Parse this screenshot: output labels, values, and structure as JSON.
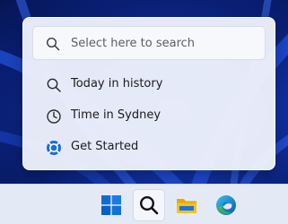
{
  "search": {
    "placeholder": "Select here to search"
  },
  "suggestions": [
    {
      "label": "Today in history",
      "icon": "search-icon"
    },
    {
      "label": "Time in Sydney",
      "icon": "clock-icon"
    },
    {
      "label": "Get Started",
      "icon": "get-started-icon"
    }
  ],
  "taskbar": {
    "items": [
      {
        "name": "start",
        "icon": "windows-logo-icon"
      },
      {
        "name": "search",
        "icon": "search-icon",
        "active": true
      },
      {
        "name": "file-explorer",
        "icon": "folder-icon"
      },
      {
        "name": "edge",
        "icon": "edge-browser-icon"
      }
    ]
  },
  "colors": {
    "wallpaper": "#1236b0",
    "flyout": "#ecf0fa",
    "taskbar": "#e4eaf5",
    "windows_blue": "#0f6cd6",
    "folder_yellow": "#f5b800"
  }
}
